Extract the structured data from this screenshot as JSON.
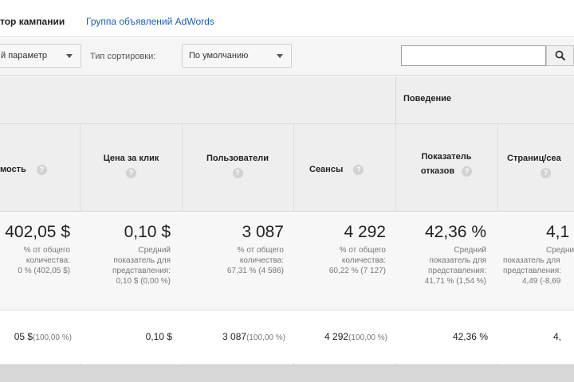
{
  "tabs": {
    "active": "тор кампании",
    "link": "Группа объявлений AdWords"
  },
  "toolbar": {
    "param_dropdown": "й параметр",
    "sort_label": "Тип сортировки:",
    "sort_dropdown": "По умолчанию",
    "search_value": ""
  },
  "group_header": "Поведение",
  "help_glyph": "?",
  "columns": {
    "cost": "мость",
    "cpc": "Цена за клик",
    "users": "Пользователи",
    "sessions": "Сеансы",
    "bounce_line1": "Показатель",
    "bounce_line2": "отказов",
    "pages": "Страниц/сеа"
  },
  "summary": {
    "cost": {
      "value": "402,05 $",
      "lines": [
        "% от общего",
        "количества:",
        "0 % (402,05 $)"
      ]
    },
    "cpc": {
      "value": "0,10 $",
      "lines": [
        "Средний",
        "показатель для",
        "представления:",
        "0,10 $ (0,00 %)"
      ]
    },
    "users": {
      "value": "3 087",
      "lines": [
        "% от общего",
        "количества:",
        "67,31 % (4 586)"
      ]
    },
    "sessions": {
      "value": "4 292",
      "lines": [
        "% от общего",
        "количества:",
        "60,22 % (7 127)"
      ]
    },
    "bounce": {
      "value": "42,36 %",
      "lines": [
        "Средний",
        "показатель для",
        "представления:",
        "41,71 % (1,54 %)"
      ]
    },
    "pages": {
      "value": "4,1",
      "lines": [
        "Средний",
        "показатель для",
        "представления:",
        "4,49 (-8,69"
      ]
    }
  },
  "row": {
    "cost": "05 $",
    "cost_pct": "(100,00 %)",
    "cpc": "0,10 $",
    "users": "3 087",
    "users_pct": "(100,00 %)",
    "sessions": "4 292",
    "sessions_pct": "(100,00 %)",
    "bounce": "42,36 %",
    "pages": "4,"
  },
  "icons": {
    "search": "search-icon",
    "caret": "chevron-down-icon",
    "help": "help-icon"
  }
}
